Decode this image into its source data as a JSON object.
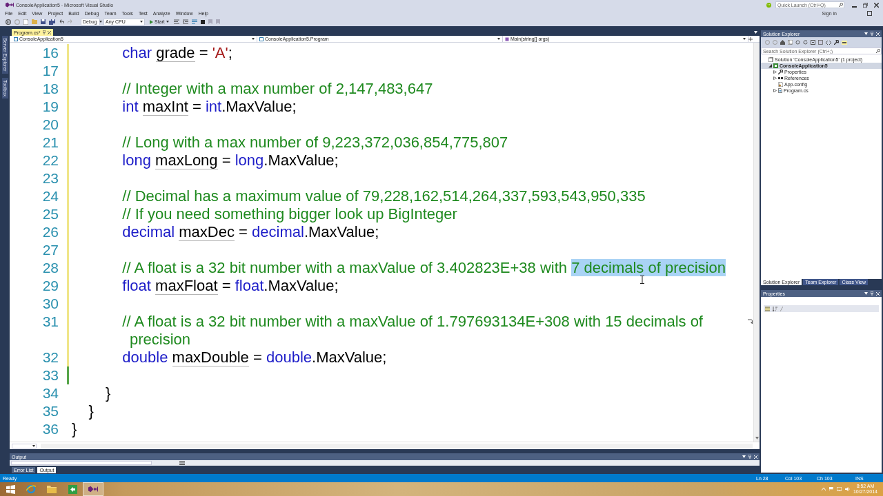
{
  "window": {
    "title": "ConsoleApplication5 - Microsoft Visual Studio",
    "quick_launch": {
      "placeholder": "Quick Launch (Ctrl+Q)"
    },
    "account": "Sign in"
  },
  "menu": [
    "File",
    "Edit",
    "View",
    "Project",
    "Build",
    "Debug",
    "Team",
    "Tools",
    "Test",
    "Analyze",
    "Window",
    "Help"
  ],
  "toolbar": {
    "configuration": "Debug",
    "platform": "Any CPU",
    "start": "Start"
  },
  "side_tabs": [
    "Server Explorer",
    "Toolbox"
  ],
  "document_tabs": [
    {
      "label": "Program.cs*",
      "selected": true
    }
  ],
  "navigation_bar": [
    "ConsoleApplication5",
    "ConsoleApplication5.Program",
    "Main(string[] args)"
  ],
  "editor": {
    "lines": [
      {
        "number": "16",
        "unsaved": true,
        "saved": false,
        "tokens": [
          {
            "kind": "keyword",
            "text": "            char",
            "selected": false
          },
          {
            "kind": "warning",
            "text": " grade",
            "selected": false
          },
          {
            "kind": "text",
            "text": " = ",
            "selected": false
          },
          {
            "kind": "char",
            "text": "'A'",
            "selected": false
          },
          {
            "kind": "text",
            "text": ";",
            "selected": false
          }
        ]
      },
      {
        "number": "17",
        "unsaved": true,
        "saved": false
      },
      {
        "number": "18",
        "unsaved": true,
        "saved": false,
        "tokens": [
          {
            "kind": "comment",
            "text": "            // Integer with a max number of 2,147,483,647",
            "selected": false
          }
        ]
      },
      {
        "number": "19",
        "unsaved": true,
        "saved": false,
        "tokens": [
          {
            "kind": "keyword",
            "text": "            int",
            "selected": false
          },
          {
            "kind": "warning",
            "text": " maxInt",
            "selected": false
          },
          {
            "kind": "text",
            "text": " = ",
            "selected": false
          },
          {
            "kind": "keyword",
            "text": "int",
            "selected": false
          },
          {
            "kind": "text",
            "text": ".MaxValue;",
            "selected": false
          }
        ]
      },
      {
        "number": "20",
        "unsaved": true,
        "saved": false
      },
      {
        "number": "21",
        "unsaved": true,
        "saved": false,
        "tokens": [
          {
            "kind": "comment",
            "text": "            // Long with a max number of 9,223,372,036,854,775,807",
            "selected": false
          }
        ]
      },
      {
        "number": "22",
        "unsaved": true,
        "saved": false,
        "tokens": [
          {
            "kind": "keyword",
            "text": "            long",
            "selected": false
          },
          {
            "kind": "warning",
            "text": " maxLong",
            "selected": false
          },
          {
            "kind": "text",
            "text": " = ",
            "selected": false
          },
          {
            "kind": "keyword",
            "text": "long",
            "selected": false
          },
          {
            "kind": "text",
            "text": ".MaxValue;",
            "selected": false
          }
        ]
      },
      {
        "number": "23",
        "unsaved": true,
        "saved": false
      },
      {
        "number": "24",
        "unsaved": true,
        "saved": false,
        "tokens": [
          {
            "kind": "comment",
            "text": "            // Decimal has a maximum value of 79,228,162,514,264,337,593,543,950,335",
            "selected": false
          }
        ]
      },
      {
        "number": "25",
        "unsaved": true,
        "saved": false,
        "tokens": [
          {
            "kind": "comment",
            "text": "            // If you need something bigger look up BigInteger",
            "selected": false
          }
        ]
      },
      {
        "number": "26",
        "unsaved": true,
        "saved": false,
        "tokens": [
          {
            "kind": "keyword",
            "text": "            decimal",
            "selected": false
          },
          {
            "kind": "warning",
            "text": " maxDec",
            "selected": false
          },
          {
            "kind": "text",
            "text": " = ",
            "selected": false
          },
          {
            "kind": "keyword",
            "text": "decimal",
            "selected": false
          },
          {
            "kind": "text",
            "text": ".MaxValue;",
            "selected": false
          }
        ]
      },
      {
        "number": "27",
        "unsaved": true,
        "saved": false
      },
      {
        "number": "28",
        "unsaved": true,
        "saved": false,
        "tokens": [
          {
            "kind": "comment",
            "text": "            // A float is a 32 bit number with a maxValue of 3.402823E+38 with ",
            "selected": false
          },
          {
            "kind": "comment",
            "text": "7 decimals of precision",
            "selected": true
          }
        ]
      },
      {
        "number": "29",
        "unsaved": true,
        "saved": false,
        "tokens": [
          {
            "kind": "keyword",
            "text": "            float",
            "selected": false
          },
          {
            "kind": "warning",
            "text": " maxFloat",
            "selected": false
          },
          {
            "kind": "text",
            "text": " = ",
            "selected": false
          },
          {
            "kind": "keyword",
            "text": "float",
            "selected": false
          },
          {
            "kind": "text",
            "text": ".MaxValue;",
            "selected": false
          }
        ]
      },
      {
        "number": "30",
        "unsaved": true,
        "saved": false
      },
      {
        "number": "31",
        "unsaved": true,
        "saved": false,
        "tokens": [
          {
            "kind": "comment",
            "text": "            // A float is a 32 bit number with a maxValue of 1.797693134E+308 with 15 decimals of",
            "selected": false
          }
        ],
        "continuation": [
          {
            "kind": "comment",
            "text": "precision",
            "selected": false
          }
        ]
      },
      {
        "number": "32",
        "unsaved": true,
        "saved": false,
        "tokens": [
          {
            "kind": "keyword",
            "text": "            double",
            "selected": false
          },
          {
            "kind": "warning",
            "text": " maxDouble",
            "selected": false
          },
          {
            "kind": "text",
            "text": " = ",
            "selected": false
          },
          {
            "kind": "keyword",
            "text": "double",
            "selected": false
          },
          {
            "kind": "text",
            "text": ".MaxValue;",
            "selected": false
          }
        ]
      },
      {
        "number": "33",
        "unsaved": false,
        "saved": true
      },
      {
        "number": "34",
        "unsaved": false,
        "saved": false,
        "tokens": [
          {
            "kind": "text",
            "text": "        }",
            "selected": false
          }
        ]
      },
      {
        "number": "35",
        "unsaved": false,
        "saved": false,
        "tokens": [
          {
            "kind": "text",
            "text": "    }",
            "selected": false
          }
        ]
      },
      {
        "number": "36",
        "unsaved": false,
        "saved": false,
        "tokens": [
          {
            "kind": "text",
            "text": "}",
            "selected": false
          }
        ]
      }
    ]
  },
  "solution_explorer": {
    "title": "Solution Explorer",
    "search": {
      "placeholder": "Search Solution Explorer (Ctrl+;)"
    },
    "tree": [
      {
        "label": "Solution 'ConsoleApplication5' (1 project)",
        "kind": "solution",
        "selected": false,
        "children": [
          {
            "label": "ConsoleApplication5",
            "kind": "project",
            "selected": true,
            "expanded": true,
            "children": [
              {
                "label": "Properties",
                "kind": "properties",
                "selected": false,
                "expanded": false
              },
              {
                "label": "References",
                "kind": "references",
                "selected": false,
                "expanded": false
              },
              {
                "label": "App.config",
                "kind": "config",
                "selected": false
              },
              {
                "label": "Program.cs",
                "kind": "code",
                "selected": false,
                "expanded": false
              }
            ]
          }
        ]
      }
    ]
  },
  "panel_tabs": [
    {
      "label": "Solution Explorer",
      "selected": true
    },
    {
      "label": "Team Explorer",
      "selected": false
    },
    {
      "label": "Class View",
      "selected": false
    }
  ],
  "properties": {
    "title": "Properties"
  },
  "output": {
    "title": "Output"
  },
  "output_tabs": [
    {
      "label": "Error List",
      "selected": false
    },
    {
      "label": "Output",
      "selected": true
    }
  ],
  "status_bar": {
    "message": "Ready",
    "line": "Ln 28",
    "column": "Col 103",
    "character": "Ch 103",
    "mode": "INS"
  },
  "taskbar": {
    "apps": [
      {
        "kind": "panes",
        "selected": false
      },
      {
        "kind": "ring",
        "selected": false
      },
      {
        "kind": "folder",
        "selected": false
      },
      {
        "kind": "tile",
        "selected": false
      },
      {
        "kind": "infinity",
        "selected": true
      }
    ],
    "time": "8:52 AM",
    "date": "10/27/2014"
  }
}
